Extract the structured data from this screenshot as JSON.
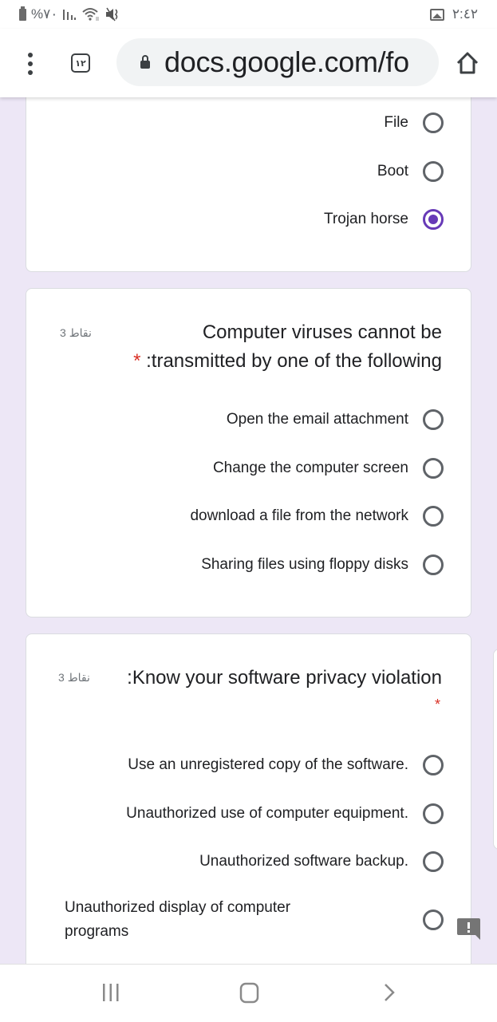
{
  "status_bar": {
    "battery_text": "%٧٠",
    "time": "٢:٤٢",
    "icons": [
      "battery-icon",
      "signal-icon",
      "wifi-icon",
      "mute-icon",
      "image-notification-icon"
    ]
  },
  "browser": {
    "tab_count": "١٢",
    "url": "docs.google.com/fo",
    "icons": [
      "menu-icon",
      "tabs-icon",
      "lock-icon",
      "home-icon"
    ]
  },
  "theme": {
    "accent": "#673ab7",
    "background": "#ede7f6",
    "required": "#d93025"
  },
  "questions": [
    {
      "id": "q-previous",
      "options": [
        {
          "label": "File",
          "selected": false
        },
        {
          "label": "Boot",
          "selected": false
        },
        {
          "label": "Trojan horse",
          "selected": true
        }
      ]
    },
    {
      "id": "q-transmission",
      "points": "3 نقاط",
      "title_line1": "Computer viruses cannot be",
      "title_line2": ":transmitted by one of the following",
      "required_mark": "*",
      "options": [
        {
          "label": "Open the email attachment",
          "selected": false
        },
        {
          "label": "Change the computer screen",
          "selected": false
        },
        {
          "label": "download a file from the network",
          "selected": false
        },
        {
          "label": "Sharing files using floppy disks",
          "selected": false
        }
      ]
    },
    {
      "id": "q-privacy",
      "points": "3 نقاط",
      "title": ":Know your software privacy violation",
      "required_mark": "*",
      "options": [
        {
          "label": "Use an unregistered copy of the software.",
          "selected": false
        },
        {
          "label": "Unauthorized use of computer equipment.",
          "selected": false
        },
        {
          "label": "Unauthorized software backup.",
          "selected": false
        },
        {
          "label": "Unauthorized display of computer programs",
          "selected": false
        }
      ]
    }
  ],
  "nav_bar": {
    "icons": [
      "recent-apps-icon",
      "home-icon",
      "back-icon"
    ]
  }
}
